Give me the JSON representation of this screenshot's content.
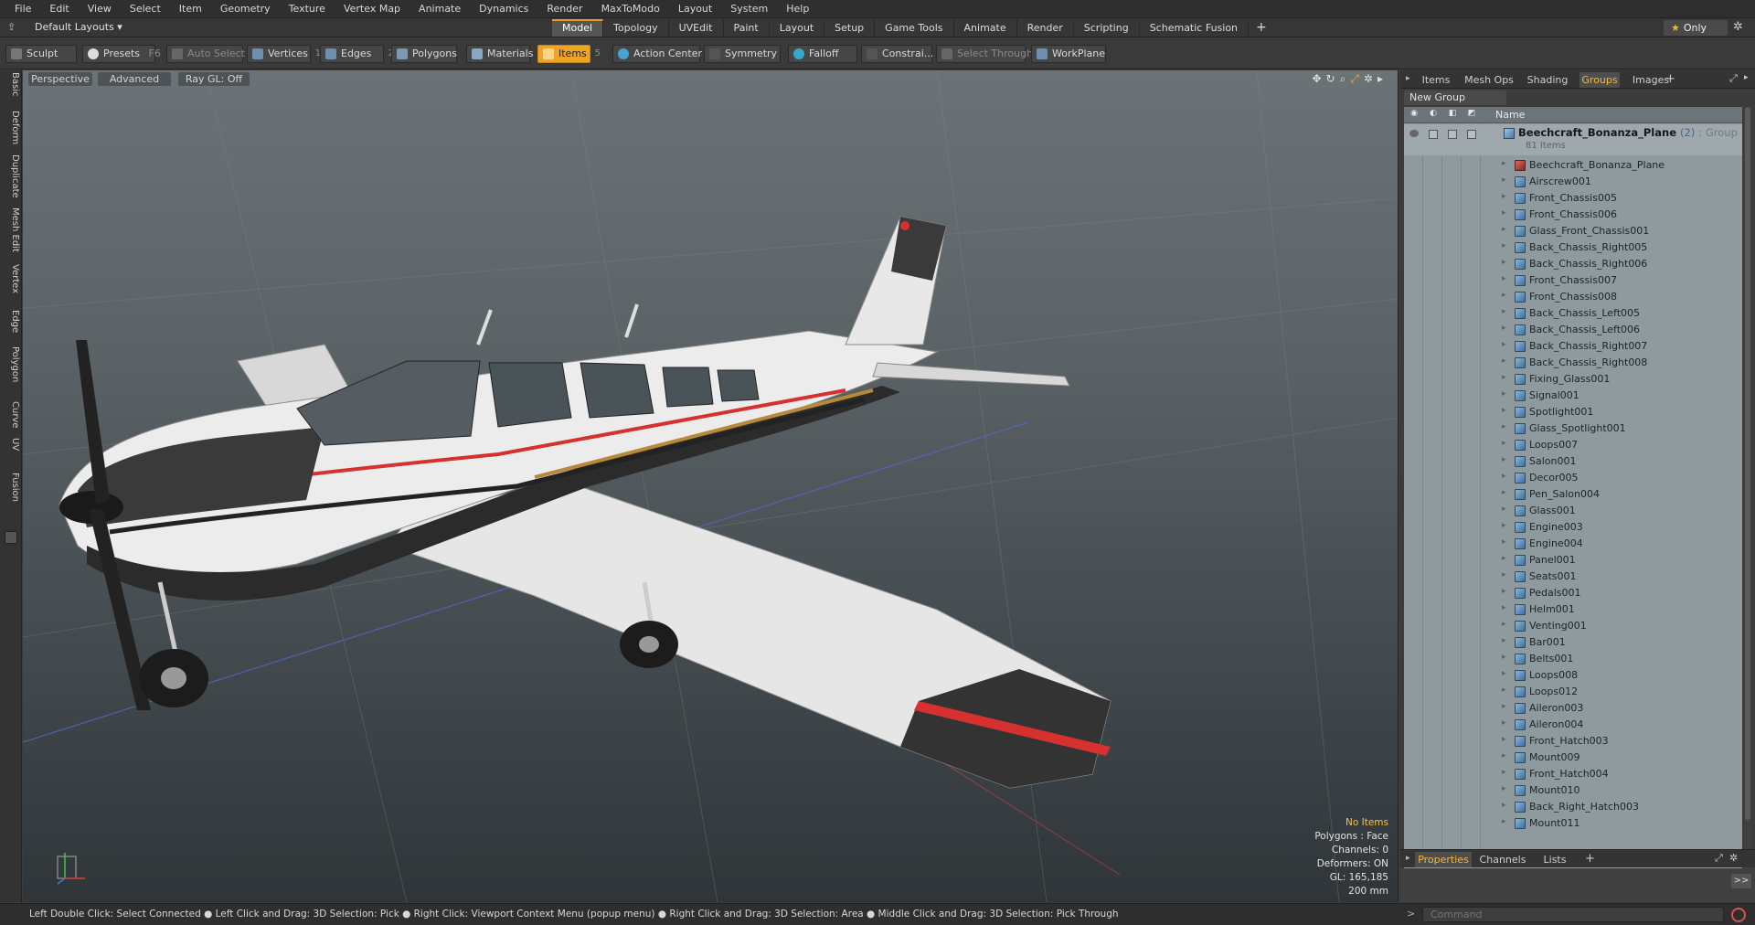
{
  "menu": [
    "File",
    "Edit",
    "View",
    "Select",
    "Item",
    "Geometry",
    "Texture",
    "Vertex Map",
    "Animate",
    "Dynamics",
    "Render",
    "MaxToModo",
    "Layout",
    "System",
    "Help"
  ],
  "layoutbar": {
    "layouts_label": "Default Layouts ▾",
    "tabs": [
      "Model",
      "Topology",
      "UVEdit",
      "Paint",
      "Layout",
      "Setup",
      "Game Tools",
      "Animate",
      "Render",
      "Scripting",
      "Schematic Fusion"
    ],
    "active_tab": "Model",
    "plus": "+",
    "only_label": "Only"
  },
  "toolbar": {
    "sculpt": "Sculpt",
    "presets": "Presets",
    "presets_key": "F6",
    "auto_select": "Auto Select",
    "vertices": "Vertices",
    "vertices_num": "1",
    "edges": "Edges",
    "edges_num": "2",
    "polygons": "Polygons",
    "materials": "Materials",
    "items": "Items",
    "items_num": "5",
    "action_center": "Action Center",
    "symmetry": "Symmetry",
    "falloff": "Falloff",
    "constraints": "Constrai...",
    "select_through": "Select Through",
    "workplane": "WorkPlane"
  },
  "lefttabs": [
    "Basic",
    "Deform",
    "Duplicate",
    "Mesh Edit",
    "Vertex",
    "Edge",
    "Polygon",
    "Curve",
    "UV",
    "Fusion"
  ],
  "viewport": {
    "view": "Perspective",
    "mode": "Advanced",
    "raygl": "Ray GL: Off",
    "info": {
      "no_items": "No Items",
      "polygons": "Polygons : Face",
      "channels": "Channels: 0",
      "deformers": "Deformers: ON",
      "gl": "GL: 165,185",
      "scale": "200 mm"
    }
  },
  "rightpanel": {
    "tabs": [
      "Items",
      "Mesh Ops",
      "Shading",
      "Groups",
      "Images"
    ],
    "active_tab": "Groups",
    "new_group": "New Group",
    "column_name": "Name",
    "group": {
      "name": "Beechcraft_Bonanza_Plane",
      "count": "(2)",
      "type": ": Group",
      "items": "81 Items"
    },
    "rows": [
      "Beechcraft_Bonanza_Plane",
      "Airscrew001",
      "Front_Chassis005",
      "Front_Chassis006",
      "Glass_Front_Chassis001",
      "Back_Chassis_Right005",
      "Back_Chassis_Right006",
      "Front_Chassis007",
      "Front_Chassis008",
      "Back_Chassis_Left005",
      "Back_Chassis_Left006",
      "Back_Chassis_Right007",
      "Back_Chassis_Right008",
      "Fixing_Glass001",
      "Signal001",
      "Spotlight001",
      "Glass_Spotlight001",
      "Loops007",
      "Salon001",
      "Decor005",
      "Pen_Salon004",
      "Glass001",
      "Engine003",
      "Engine004",
      "Panel001",
      "Seats001",
      "Pedals001",
      "Helm001",
      "Venting001",
      "Bar001",
      "Belts001",
      "Loops008",
      "Loops012",
      "Aileron003",
      "Aileron004",
      "Front_Hatch003",
      "Mount009",
      "Front_Hatch004",
      "Mount010",
      "Back_Right_Hatch003",
      "Mount011"
    ],
    "bottom_tabs": [
      "Properties",
      "Channels",
      "Lists"
    ],
    "bottom_active": "Properties",
    "expand": ">>"
  },
  "statusbar": {
    "hint": "Left Double Click: Select Connected ● Left Click and Drag: 3D Selection: Pick ● Right Click: Viewport Context Menu (popup menu) ● Right Click and Drag: 3D Selection: Area ● Middle Click and Drag: 3D Selection: Pick Through",
    "prompt": ">",
    "command_placeholder": "Command"
  },
  "colors": {
    "accent": "#f0a424",
    "active_tab_text": "#f5b642",
    "list_bg": "#8f9a9e"
  }
}
